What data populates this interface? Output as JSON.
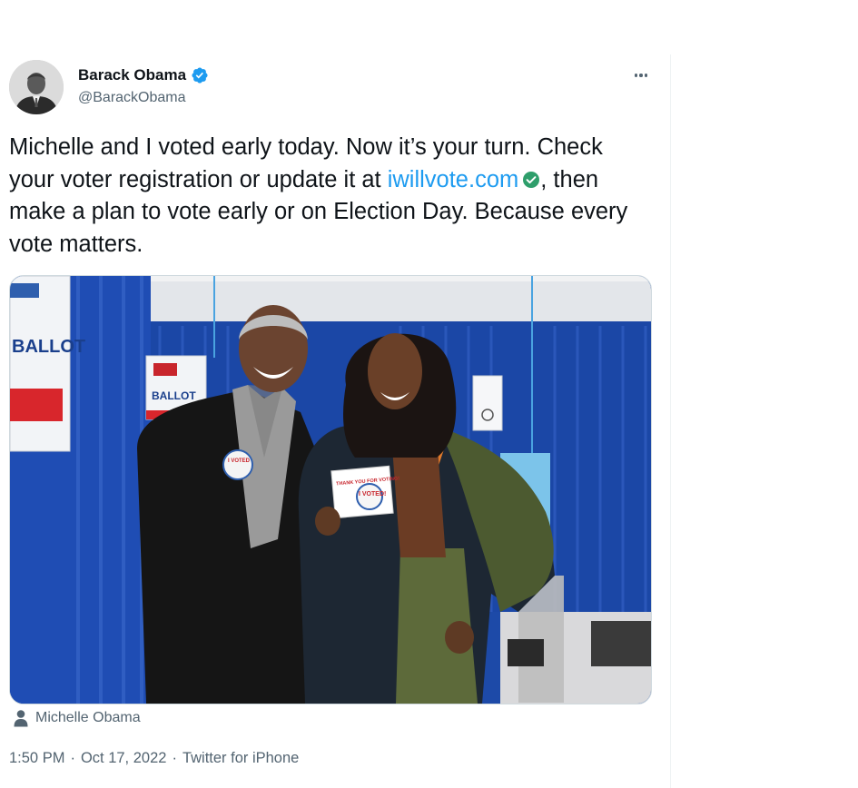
{
  "author": {
    "name": "Barack Obama",
    "handle": "@BarackObama"
  },
  "tweet": {
    "text_before_link": "Michelle and I voted early today. Now it’s your turn. Check your voter registration or update it at ",
    "link_text": "iwillvote.com",
    "text_after_link": ", then make a plan to vote early or on Election Day. Because every vote matters."
  },
  "photo": {
    "sign_left": "BALLOT",
    "sign_center": "BALLOT",
    "card_header": "THANK YOU FOR VOTING!",
    "card_title": "I VOTED!",
    "button_text": "I VOTED"
  },
  "media_tag": {
    "label": "Michelle Obama"
  },
  "meta": {
    "time": "1:50 PM",
    "separator": "·",
    "date": "Oct 17, 2022",
    "source": "Twitter for iPhone"
  },
  "colors": {
    "link": "#1d9bf0",
    "verified": "#1d9bf0",
    "link_check": "#2e9e6b",
    "secondary_text": "#536471"
  }
}
